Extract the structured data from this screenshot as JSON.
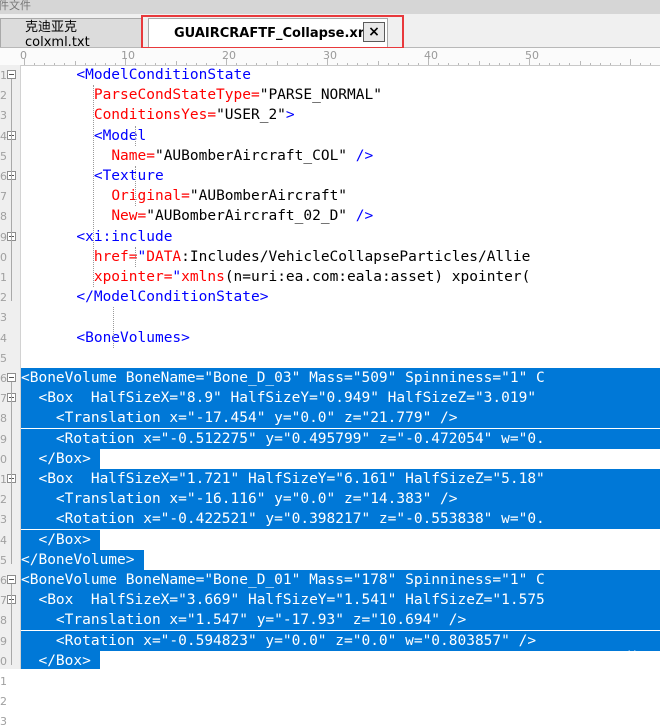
{
  "window": {
    "title_fragment": "件文件"
  },
  "tabs": [
    {
      "label": "克迪亚克colxml.txt",
      "active": false
    },
    {
      "label": "GUAIRCRAFTF_Collapse.xml",
      "active": true
    }
  ],
  "close_label": "×",
  "ruler": {
    "labels": [
      "0",
      "10",
      "20",
      "30",
      "40",
      "50"
    ]
  },
  "gutter_numbers": [
    "1",
    "2",
    "3",
    "4",
    "5",
    "6",
    "7",
    "8",
    "9",
    "0",
    "1",
    "2",
    "3",
    "4",
    "5",
    "6",
    "7",
    "8",
    "9",
    "0",
    "1",
    "2",
    "3",
    "4",
    "5",
    "6",
    "7",
    "8",
    "9",
    "0",
    "1",
    "2",
    "3"
  ],
  "code_lines": [
    "      <ModelConditionState",
    "        ParseCondStateType=\"PARSE_NORMAL\"",
    "        ConditionsYes=\"USER_2\">",
    "        <Model",
    "          Name=\"AUBomberAircraft_COL\" />",
    "        <Texture",
    "          Original=\"AUBomberAircraft\"",
    "          New=\"AUBomberAircraft_02_D\" />",
    "      <xi:include",
    "        href=\"DATA:Includes/VehicleCollapseParticles/Allie",
    "        xpointer=\"xmlns(n=uri:ea.com:eala:asset) xpointer(",
    "      </ModelConditionState>",
    "",
    "      <BoneVolumes>",
    "",
    "<BoneVolume BoneName=\"Bone_D_03\" Mass=\"509\" Spinniness=\"1\" C",
    "  <Box  HalfSizeX=\"8.9\" HalfSizeY=\"0.949\" HalfSizeZ=\"3.019\"",
    "    <Translation x=\"-17.454\" y=\"0.0\" z=\"21.779\" />",
    "    <Rotation x=\"-0.512275\" y=\"0.495799\" z=\"-0.472054\" w=\"0.",
    "  </Box>",
    "  <Box  HalfSizeX=\"1.721\" HalfSizeY=\"6.161\" HalfSizeZ=\"5.18\"",
    "    <Translation x=\"-16.116\" y=\"0.0\" z=\"14.383\" />",
    "    <Rotation x=\"-0.422521\" y=\"0.398217\" z=\"-0.553838\" w=\"0.",
    "  </Box>",
    "</BoneVolume>",
    "<BoneVolume BoneName=\"Bone_D_01\" Mass=\"178\" Spinniness=\"1\" C",
    "  <Box  HalfSizeX=\"3.669\" HalfSizeY=\"1.541\" HalfSizeZ=\"1.575",
    "    <Translation x=\"1.547\" y=\"-17.93\" z=\"10.694\" />",
    "    <Rotation x=\"-0.594823\" y=\"0.0\" z=\"0.0\" w=\"0.803857\" />",
    "  </Box>"
  ],
  "selection_start": 15,
  "watermark": "l 蓝天"
}
